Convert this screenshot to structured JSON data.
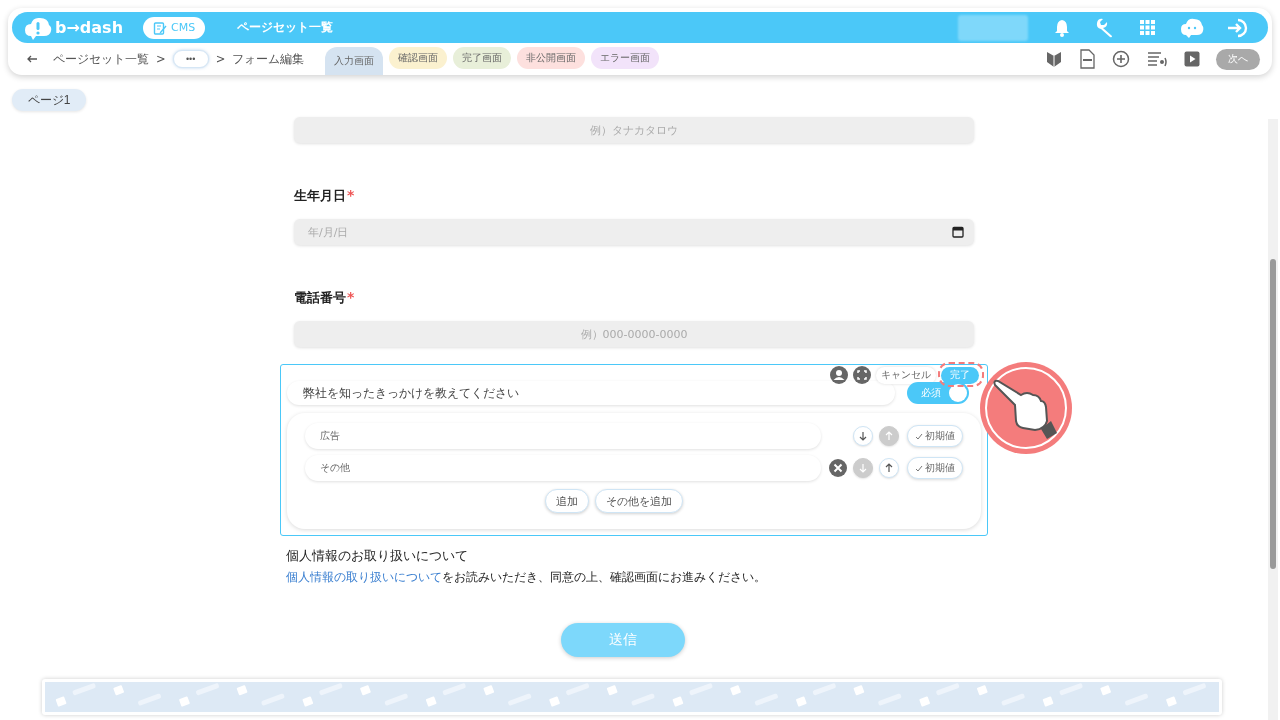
{
  "header": {
    "logo": "b→dash",
    "cms_badge": "CMS",
    "title": "ページセット一覧"
  },
  "breadcrumb": {
    "separator": ">",
    "items": [
      {
        "kind": "link",
        "label": "ページセット一覧"
      },
      {
        "kind": "more",
        "label": "•••"
      },
      {
        "kind": "text",
        "label": "フォーム編集"
      }
    ]
  },
  "screen_tabs": [
    {
      "label": "入力画面",
      "selected": true,
      "color": "#d5e3f1"
    },
    {
      "label": "確認画面",
      "selected": false,
      "color": "#fbf1cf"
    },
    {
      "label": "完了画面",
      "selected": false,
      "color": "#e8efd9"
    },
    {
      "label": "非公開画面",
      "selected": false,
      "color": "#fde0de"
    },
    {
      "label": "エラー画面",
      "selected": false,
      "color": "#f2e3fa"
    }
  ],
  "next_button": {
    "label": "次へ",
    "disabled": true
  },
  "page_tabs": [
    {
      "label": "ページ1",
      "selected": true
    }
  ],
  "form": {
    "fields": [
      {
        "kind": "text",
        "placeholder": "例）タナカタロウ"
      },
      {
        "kind": "date",
        "label": "生年月日",
        "required": true,
        "required_mark": "*",
        "placeholder": "年/月/日"
      },
      {
        "kind": "text",
        "label": "電話番号",
        "required": true,
        "required_mark": "*",
        "placeholder": "例）000-0000-0000"
      }
    ]
  },
  "editor": {
    "question": "弊社を知ったきっかけを教えてください",
    "cancel_button": "キャンセル",
    "done_button": "完了",
    "required_toggle": {
      "label": "必須",
      "on": true
    },
    "options": [
      {
        "value": "広告",
        "removable": false,
        "down_disabled": false,
        "up_disabled": true,
        "default_label": "初期値"
      },
      {
        "value": "その他",
        "removable": true,
        "down_disabled": true,
        "up_disabled": false,
        "default_label": "初期値"
      }
    ],
    "add_button": "追加",
    "add_other_button": "その他を追加"
  },
  "privacy": {
    "heading": "個人情報のお取り扱いについて",
    "link": "個人情報の取り扱いについて",
    "text": "をお読みいただき、同意の上、確認画面にお進みください。"
  },
  "submit_button": "送信"
}
